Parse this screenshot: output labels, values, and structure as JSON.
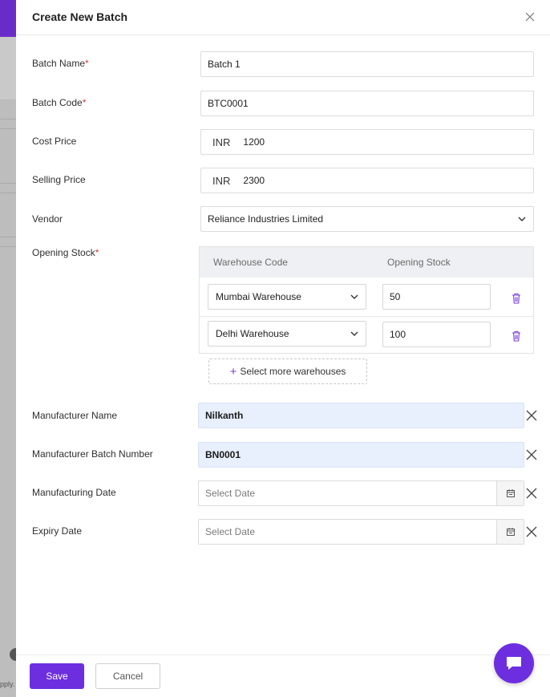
{
  "title": "Create New Batch",
  "required_mark": "*",
  "fields": {
    "batch_name": {
      "label": "Batch Name",
      "value": "Batch 1"
    },
    "batch_code": {
      "label": "Batch Code",
      "value": "BTC0001"
    },
    "cost_price": {
      "label": "Cost Price",
      "currency": "INR",
      "value": "1200"
    },
    "selling_price": {
      "label": "Selling Price",
      "currency": "INR",
      "value": "2300"
    },
    "vendor": {
      "label": "Vendor",
      "value": "Reliance Industries Limited"
    },
    "opening_stock": {
      "label": "Opening Stock"
    },
    "manufacturer_name": {
      "label": "Manufacturer Name",
      "value": "Nilkanth"
    },
    "manufacturer_batch_number": {
      "label": "Manufacturer Batch Number",
      "value": "BN0001"
    },
    "manufacturing_date": {
      "label": "Manufacturing Date",
      "placeholder": "Select Date"
    },
    "expiry_date": {
      "label": "Expiry Date",
      "placeholder": "Select Date"
    }
  },
  "warehouse_table": {
    "headers": [
      "Warehouse Code",
      "Opening Stock"
    ],
    "rows": [
      {
        "warehouse": "Mumbai Warehouse",
        "stock": "50"
      },
      {
        "warehouse": "Delhi Warehouse",
        "stock": "100"
      }
    ],
    "add_label": "Select more warehouses"
  },
  "footer": {
    "save_label": "Save",
    "cancel_label": "Cancel"
  },
  "background": {
    "fragment_text": "pply."
  },
  "colors": {
    "accent": "#6d2ee0",
    "required": "#d43c3c",
    "highlight_field": "#e8effd"
  },
  "icons": [
    "close-icon",
    "chevron-down-icon",
    "trash-icon",
    "plus-icon",
    "calendar-icon",
    "clear-icon",
    "chat-icon",
    "help-icon"
  ]
}
